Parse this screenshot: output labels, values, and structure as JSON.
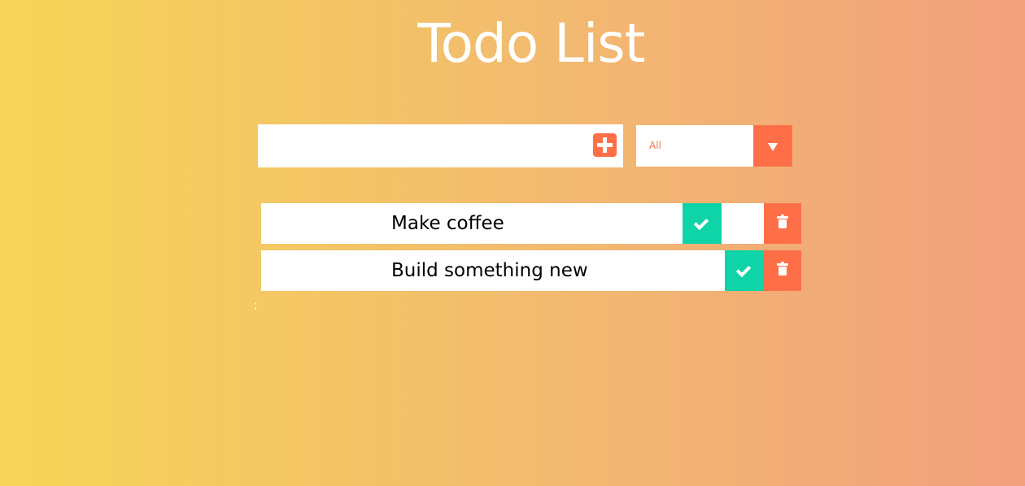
{
  "header": {
    "title": "Todo List"
  },
  "form": {
    "input_value": "",
    "add_icon": "plus-square-icon"
  },
  "filter": {
    "selected": "All",
    "arrow_icon": "triangle-down-icon"
  },
  "todos": [
    {
      "text": "Make coffee",
      "complete_icon": "check-icon",
      "delete_icon": "trash-icon"
    },
    {
      "text": "Build something new",
      "complete_icon": "check-icon",
      "delete_icon": "trash-icon"
    }
  ],
  "footer_text": ";",
  "colors": {
    "gradient_start": "#f6d556",
    "gradient_end": "#f2a07e",
    "accent": "#ff6f47",
    "complete": "#0fd4a7",
    "text_white": "#ffffff"
  }
}
